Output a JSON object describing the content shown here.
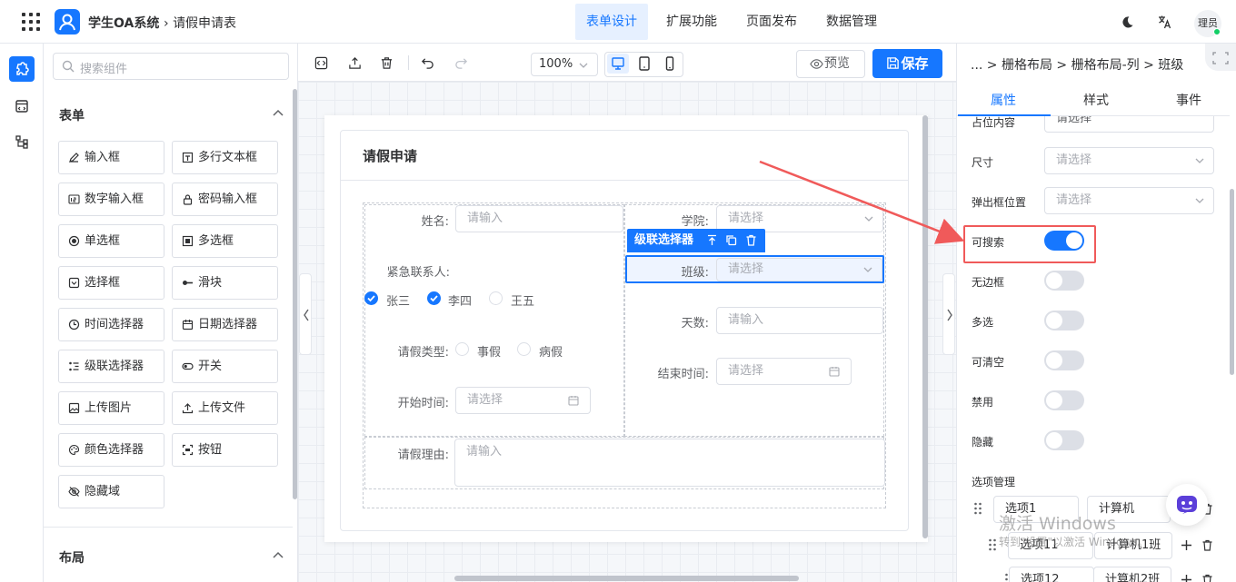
{
  "header": {
    "app_name": "学生OA系统",
    "breadcrumb": "请假申请表",
    "tabs": [
      {
        "label": "表单设计",
        "active": true
      },
      {
        "label": "扩展功能",
        "active": false
      },
      {
        "label": "页面发布",
        "active": false
      },
      {
        "label": "数据管理",
        "active": false
      }
    ],
    "user": "理员"
  },
  "components": {
    "search_placeholder": "搜索组件",
    "form_section": "表单",
    "items": [
      {
        "label": "输入框",
        "icon": "pencil-icon"
      },
      {
        "label": "多行文本框",
        "icon": "textarea-icon"
      },
      {
        "label": "数字输入框",
        "icon": "number-icon"
      },
      {
        "label": "密码输入框",
        "icon": "lock-icon"
      },
      {
        "label": "单选框",
        "icon": "radio-icon"
      },
      {
        "label": "多选框",
        "icon": "checkbox-icon"
      },
      {
        "label": "选择框",
        "icon": "select-icon"
      },
      {
        "label": "滑块",
        "icon": "slider-icon"
      },
      {
        "label": "时间选择器",
        "icon": "clock-icon"
      },
      {
        "label": "日期选择器",
        "icon": "calendar-icon"
      },
      {
        "label": "级联选择器",
        "icon": "cascader-icon"
      },
      {
        "label": "开关",
        "icon": "switch-icon"
      },
      {
        "label": "上传图片",
        "icon": "image-icon"
      },
      {
        "label": "上传文件",
        "icon": "upload-icon"
      },
      {
        "label": "颜色选择器",
        "icon": "palette-icon"
      },
      {
        "label": "按钮",
        "icon": "button-icon"
      },
      {
        "label": "隐藏域",
        "icon": "eye-off-icon"
      }
    ],
    "layout_section": "布局"
  },
  "toolbar": {
    "zoom": "100%",
    "preview": "预览",
    "save": "保存"
  },
  "form": {
    "title": "请假申请",
    "name_label": "姓名:",
    "name_placeholder": "请输入",
    "college_label": "学院:",
    "college_placeholder": "请选择",
    "contact_label": "紧急联系人:",
    "contacts": [
      {
        "label": "张三",
        "checked": true
      },
      {
        "label": "李四",
        "checked": true
      },
      {
        "label": "王五",
        "checked": false
      }
    ],
    "selected_tag": "级联选择器",
    "class_label": "班级:",
    "class_placeholder": "请选择",
    "days_label": "天数:",
    "days_placeholder": "请输入",
    "type_label": "请假类型:",
    "types": [
      "事假",
      "病假"
    ],
    "start_label": "开始时间:",
    "start_placeholder": "请选择",
    "end_label": "结束时间:",
    "end_placeholder": "请选择",
    "reason_label": "请假理由:",
    "reason_placeholder": "请输入"
  },
  "props": {
    "breadcrumb": "... > 栅格布局 > 栅格布局-列 > 班级",
    "tabs": [
      "属性",
      "样式",
      "事件"
    ],
    "placeholder_label": "占位内容",
    "placeholder_value": "请选择",
    "size_label": "尺寸",
    "size_placeholder": "请选择",
    "popup_label": "弹出框位置",
    "popup_placeholder": "请选择",
    "switches": [
      {
        "label": "可搜索",
        "on": true
      },
      {
        "label": "无边框",
        "on": false
      },
      {
        "label": "多选",
        "on": false
      },
      {
        "label": "可清空",
        "on": false
      },
      {
        "label": "禁用",
        "on": false
      },
      {
        "label": "隐藏",
        "on": false
      }
    ],
    "options_label": "选项管理",
    "options": [
      {
        "label": "选项1",
        "value": "计算机"
      },
      {
        "label": "选项11",
        "value": "计算机1班"
      },
      {
        "label": "选项12",
        "value": "计算机2班"
      }
    ]
  },
  "watermark": {
    "line1": "激活 Windows",
    "line2": "转到\"设置\"以激活 Windows。"
  }
}
